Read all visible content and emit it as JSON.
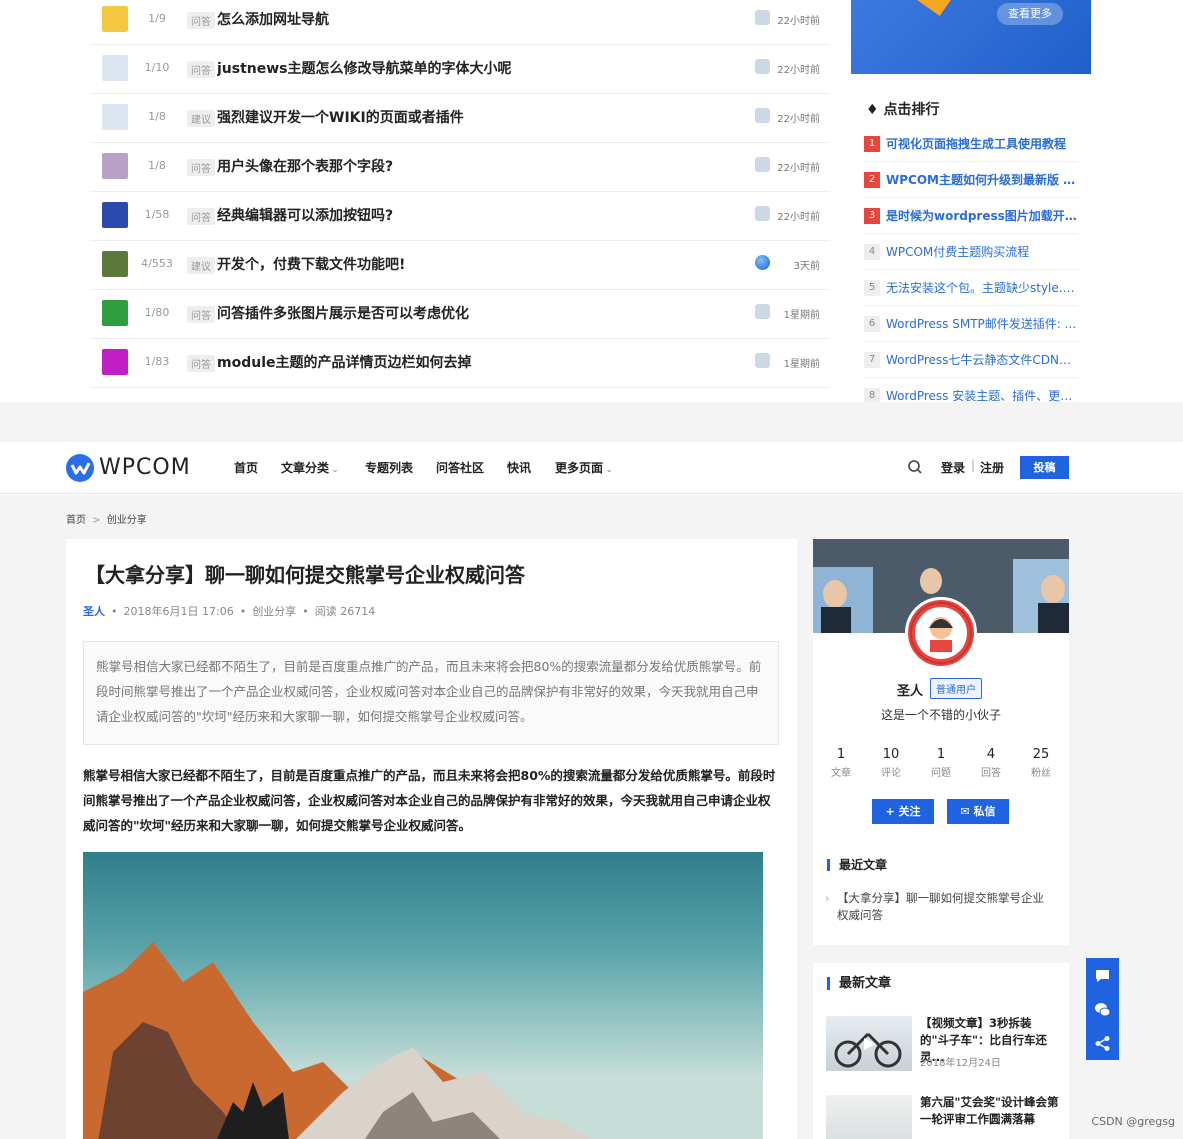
{
  "qa_list": [
    {
      "count": "1/9",
      "tag": "问答",
      "title": "怎么添加网址导航",
      "time": "22小时前",
      "avatar_color": "#f5c842",
      "user_icon": "user-icon"
    },
    {
      "count": "1/10",
      "tag": "问答",
      "title": "justnews主题怎么修改导航菜单的字体大小呢",
      "time": "22小时前",
      "avatar_color": "#dde6f0",
      "user_icon": "user-icon"
    },
    {
      "count": "1/8",
      "tag": "建议",
      "title": "强烈建议开发一个WIKI的页面或者插件",
      "time": "22小时前",
      "avatar_color": "#dde6f0",
      "user_icon": "user-icon"
    },
    {
      "count": "1/8",
      "tag": "问答",
      "title": "用户头像在那个表那个字段?",
      "time": "22小时前",
      "avatar_color": "#b9a0c6",
      "user_icon": "user-icon"
    },
    {
      "count": "1/58",
      "tag": "问答",
      "title": "经典编辑器可以添加按钮吗?",
      "time": "22小时前",
      "avatar_color": "#2a4ab0",
      "user_icon": "user-icon"
    },
    {
      "count": "4/553",
      "tag": "建议",
      "title": "开发个，付费下载文件功能吧!",
      "time": "3天前",
      "avatar_color": "#5b7a3a",
      "user_icon": "globe-icon"
    },
    {
      "count": "1/80",
      "tag": "问答",
      "title": "问答插件多张图片展示是否可以考虑优化",
      "time": "1星期前",
      "avatar_color": "#2e9e3e",
      "user_icon": "user-icon"
    },
    {
      "count": "1/83",
      "tag": "问答",
      "title": "module主题的产品详情页边栏如何去掉",
      "time": "1星期前",
      "avatar_color": "#c21ec8",
      "user_icon": "user-icon"
    }
  ],
  "banner": {
    "button": "查看更多"
  },
  "rank": {
    "title": "点击排行",
    "items": [
      {
        "no": "1",
        "title": "可视化页面拖拽生成工具使用教程"
      },
      {
        "no": "2",
        "title": "WPCOM主题如何升级到最新版 主..."
      },
      {
        "no": "3",
        "title": "是时候为wordpress图片加载开挂..."
      },
      {
        "no": "4",
        "title": "WPCOM付费主题购买流程"
      },
      {
        "no": "5",
        "title": "无法安装这个包。主题缺少style.c..."
      },
      {
        "no": "6",
        "title": "WordPress SMTP邮件发送插件: ..."
      },
      {
        "no": "7",
        "title": "WordPress七牛云静态文件CDN加..."
      },
      {
        "no": "8",
        "title": "WordPress 安装主题、插件、更新..."
      }
    ]
  },
  "header": {
    "logo": "WPCOM",
    "nav": [
      "首页",
      "文章分类",
      "专题列表",
      "问答社区",
      "快讯",
      "更多页面"
    ],
    "login": "登录",
    "separator": "|",
    "register": "注册",
    "post": "投稿"
  },
  "breadcrumb": {
    "home": "首页",
    "sep": ">",
    "current": "创业分享"
  },
  "article": {
    "title": "【大拿分享】聊一聊如何提交熊掌号企业权威问答",
    "author": "圣人",
    "date": "2018年6月1日 17:06",
    "category": "创业分享",
    "reads": "阅读 26714",
    "excerpt": "熊掌号相信大家已经都不陌生了，目前是百度重点推广的产品，而且未来将会把80%的搜索流量都分发给优质熊掌号。前段时间熊掌号推出了一个产品企业权威问答，企业权威问答对本企业自己的品牌保护有非常好的效果，今天我就用自己申请企业权威问答的\"坎坷\"经历来和大家聊一聊，如何提交熊掌号企业权威问答。",
    "body": "熊掌号相信大家已经都不陌生了，目前是百度重点推广的产品，而且未来将会把80%的搜索流量都分发给优质熊掌号。前段时间熊掌号推出了一个产品企业权威问答，企业权威问答对本企业自己的品牌保护有非常好的效果，今天我就用自己申请企业权威问答的\"坎坷\"经历来和大家聊一聊，如何提交熊掌号企业权威问答。"
  },
  "profile": {
    "name": "圣人",
    "badge": "普通用户",
    "desc": "这是一个不错的小伙子",
    "stats": [
      {
        "num": "1",
        "label": "文章"
      },
      {
        "num": "10",
        "label": "评论"
      },
      {
        "num": "1",
        "label": "问题"
      },
      {
        "num": "4",
        "label": "回答"
      },
      {
        "num": "25",
        "label": "粉丝"
      }
    ],
    "follow": "+ 关注",
    "message": "私信",
    "recent_title": "最近文章",
    "recent_item": "【大拿分享】聊一聊如何提交熊掌号企业权威问答"
  },
  "newest": {
    "title": "最新文章",
    "items": [
      {
        "title": "【视频文章】3秒拆装的\"斗子车\"：比自行车还灵...",
        "date": "2018年12月24日"
      },
      {
        "title": "第六届\"艾会奖\"设计峰会第一轮评审工作圆满落幕",
        "date": ""
      }
    ]
  },
  "watermark": "CSDN @gregsg",
  "colors": {
    "accent": "#1f63e0",
    "link": "#2a6dd8",
    "rank_hot": "#e6463e"
  }
}
